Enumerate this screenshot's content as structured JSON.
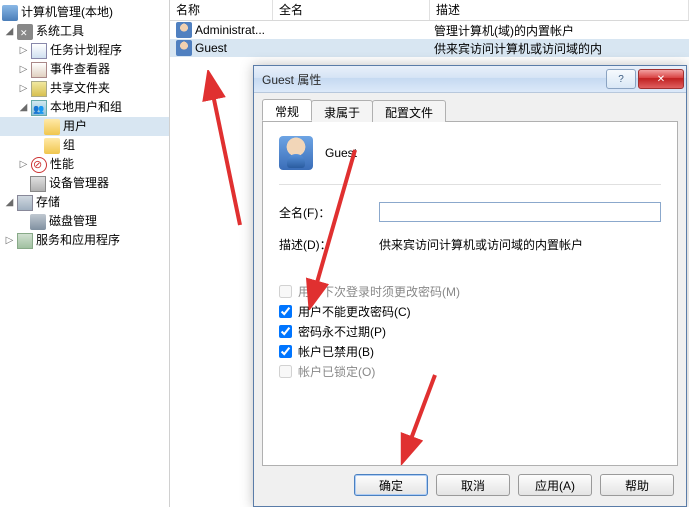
{
  "tree": {
    "root": "计算机管理(本地)",
    "system_tools": "系统工具",
    "task_scheduler": "任务计划程序",
    "event_viewer": "事件查看器",
    "shared_folders": "共享文件夹",
    "local_users_groups": "本地用户和组",
    "users": "用户",
    "groups": "组",
    "performance": "性能",
    "device_manager": "设备管理器",
    "storage": "存储",
    "disk_mgmt": "磁盘管理",
    "services_apps": "服务和应用程序"
  },
  "list": {
    "col_name": "名称",
    "col_fullname": "全名",
    "col_desc": "描述",
    "rows": [
      {
        "name": "Administrat...",
        "fullname": "",
        "desc": "管理计算机(域)的内置帐户"
      },
      {
        "name": "Guest",
        "fullname": "",
        "desc": "供来宾访问计算机或访问域的内"
      }
    ]
  },
  "dialog": {
    "title": "Guest 属性",
    "tabs": {
      "general": "常规",
      "memberof": "隶属于",
      "profile": "配置文件"
    },
    "username": "Guest",
    "fullname_label": "全名(F)：",
    "fullname_value": "",
    "desc_label": "描述(D)：",
    "desc_value": "供来宾访问计算机或访问域的内置帐户",
    "check_mustchange": "用户下次登录时须更改密码(M)",
    "check_cannotchange": "用户不能更改密码(C)",
    "check_neverexpire": "密码永不过期(P)",
    "check_disabled": "帐户已禁用(B)",
    "check_locked": "帐户已锁定(O)",
    "btn_ok": "确定",
    "btn_cancel": "取消",
    "btn_apply": "应用(A)",
    "btn_help": "帮助"
  }
}
